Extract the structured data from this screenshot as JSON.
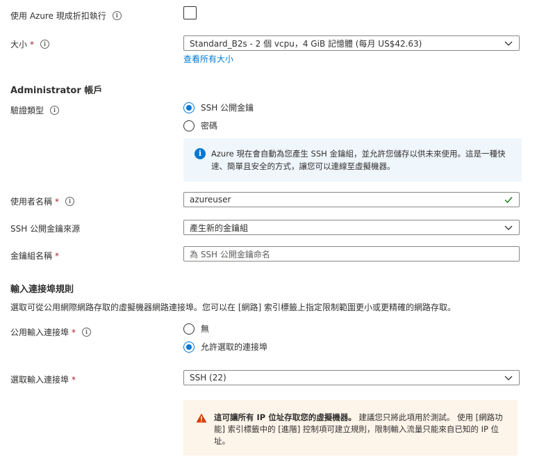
{
  "spot": {
    "label": "使用 Azure 現成折扣執行"
  },
  "size": {
    "label": "大小",
    "value": "Standard_B2s - 2 個 vcpu，4 GiB 記憶體 (每月 US$42.63)",
    "link": "查看所有大小"
  },
  "admin": {
    "title": "Administrator 帳戶",
    "auth_label": "驗證類型",
    "auth_options": [
      "SSH 公開金鑰",
      "密碼"
    ],
    "info_text": "Azure 現在會自動為您產生 SSH 金鑰組，並允許您儲存以供未來使用。這是一種快速、簡單且安全的方式，讓您可以連線至虛擬機器。",
    "username_label": "使用者名稱",
    "username_value": "azureuser",
    "ssh_source_label": "SSH 公開金鑰來源",
    "ssh_source_value": "產生新的金鑰組",
    "keypair_label": "金鑰組名稱",
    "keypair_placeholder": "為 SSH 公開金鑰命名"
  },
  "inbound": {
    "title": "輸入連接埠規則",
    "description": "選取可從公用網際網路存取的虛擬機器網路連接埠。您可以在 [網路] 索引標籤上指定限制範圍更小或更精確的網路存取。",
    "public_label": "公用輸入連接埠",
    "public_options": [
      "無",
      "允許選取的連接埠"
    ],
    "select_label": "選取輸入連接埠",
    "select_value": "SSH (22)",
    "warning_bold": "這可讓所有 IP 位址存取您的虛擬機器。",
    "warning_text": " 建議您只將此項用於測試。 使用 [網路功能] 索引標籤中的 [進階] 控制項可建立規則，限制輸入流量只能來自已知的 IP 位址。"
  },
  "colors": {
    "accent": "#0078d4",
    "required": "#a4262c",
    "success": "#107c10",
    "warning": "#d83b01"
  },
  "icons": {
    "info": "info-icon",
    "chevron": "chevron-down-icon",
    "check": "checkmark-icon",
    "warning": "warning-icon"
  }
}
